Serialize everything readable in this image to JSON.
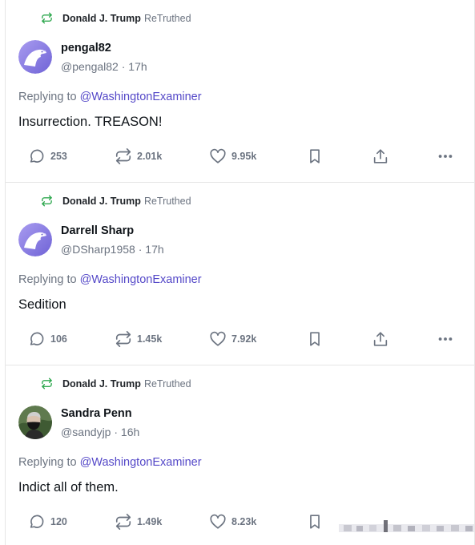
{
  "posts": [
    {
      "retruth_by": "Donald J. Trump",
      "retruth_tag": "ReTruthed",
      "display_name": "pengal82",
      "handle": "@pengal82",
      "time": "17h",
      "replying_prefix": "Replying to",
      "replying_to": "@WashingtonExaminer",
      "text": "Insurrection. TREASON!",
      "replies": "253",
      "retruths": "2.01k",
      "likes": "9.95k",
      "avatar": "eagle-avatar"
    },
    {
      "retruth_by": "Donald J. Trump",
      "retruth_tag": "ReTruthed",
      "display_name": "Darrell Sharp",
      "handle": "@DSharp1958",
      "time": "17h",
      "replying_prefix": "Replying to",
      "replying_to": "@WashingtonExaminer",
      "text": "Sedition",
      "replies": "106",
      "retruths": "1.45k",
      "likes": "7.92k",
      "avatar": "eagle-avatar"
    },
    {
      "retruth_by": "Donald J. Trump",
      "retruth_tag": "ReTruthed",
      "display_name": "Sandra Penn",
      "handle": "@sandyjp",
      "time": "16h",
      "replying_prefix": "Replying to",
      "replying_to": "@WashingtonExaminer",
      "text": "Indict all of them.",
      "replies": "120",
      "retruths": "1.49k",
      "likes": "8.23k",
      "avatar": "photo-avatar"
    }
  ],
  "colors": {
    "accent_link": "#5448c8",
    "retruth_icon": "#2fa84f",
    "muted_text": "#6b7380",
    "divider": "#e6e6e6"
  }
}
